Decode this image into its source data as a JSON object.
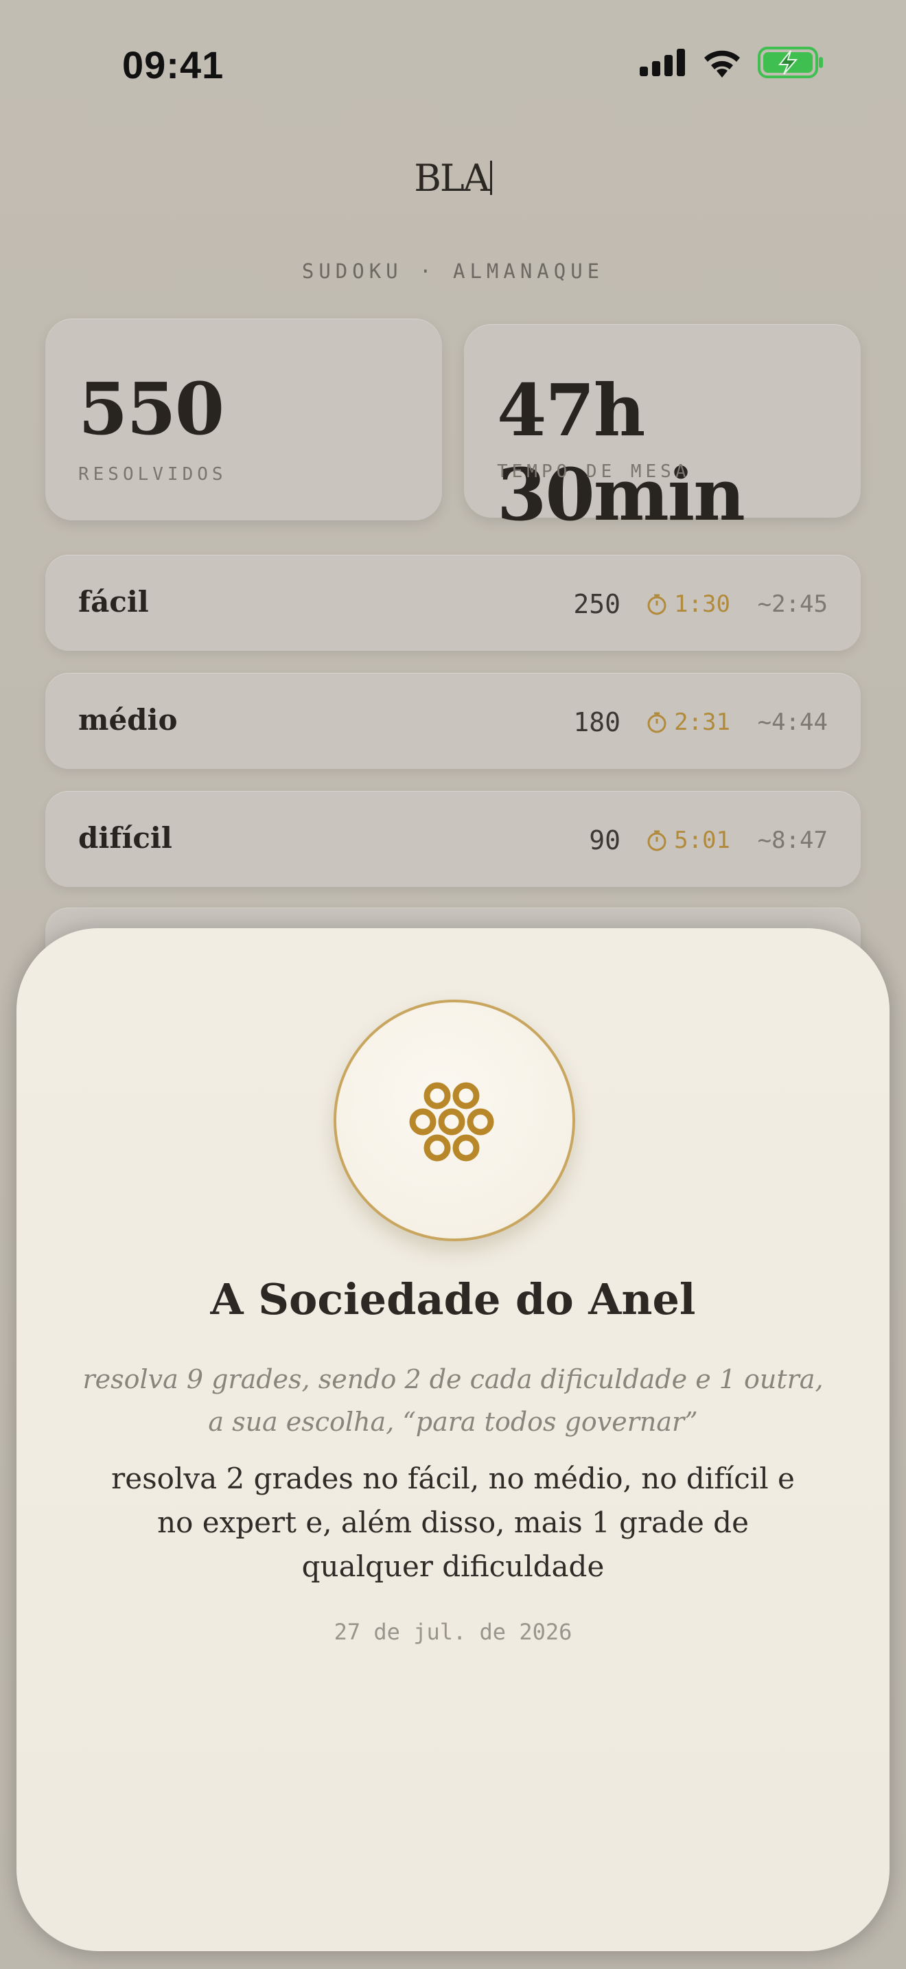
{
  "status_bar": {
    "time": "09:41"
  },
  "brand": "BLA",
  "subtitle": "SUDOKU · ALMANAQUE",
  "stats": [
    {
      "value": "550",
      "label": "RESOLVIDOS"
    },
    {
      "value": "47h 30min",
      "label": "TEMPO DE MESA"
    }
  ],
  "difficulties": [
    {
      "name": "fácil",
      "count": "250",
      "best": "1:30",
      "avg": "~2:45"
    },
    {
      "name": "médio",
      "count": "180",
      "best": "2:31",
      "avg": "~4:44"
    },
    {
      "name": "difícil",
      "count": "90",
      "best": "5:01",
      "avg": "~8:47"
    }
  ],
  "achievement": {
    "title": "A Sociedade do Anel",
    "flavor": "resolva 9 grades, sendo 2 de cada dificuldade e 1 outra, a sua escolha, “para todos governar”",
    "description": "resolva 2 grades no fácil, no médio, no difícil e no expert e, além disso, mais 1 grade de qualquer dificuldade",
    "date": "27 de jul. de 2026",
    "icon": "rings-icon"
  },
  "colors": {
    "accent": "#b18a3b",
    "battery": "#3fbf4f"
  }
}
